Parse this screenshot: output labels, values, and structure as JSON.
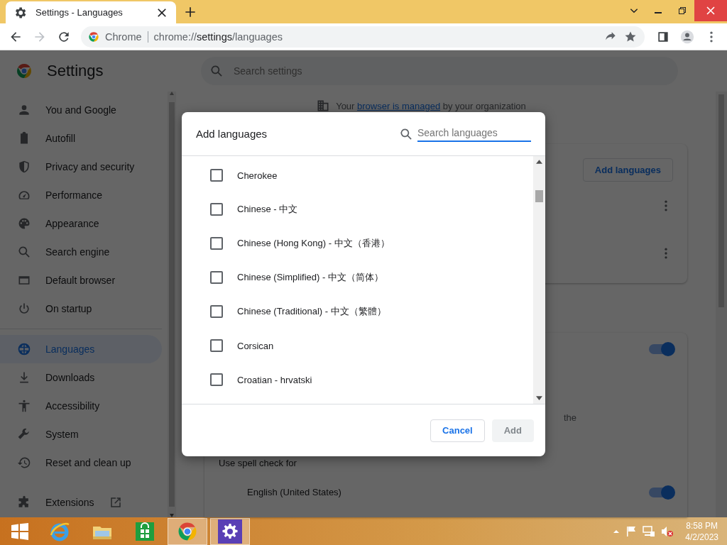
{
  "browser": {
    "tabs": [
      {
        "title": "Settings - Languages",
        "selected": true
      }
    ],
    "address": {
      "site": "Chrome",
      "url_host": "chrome://",
      "url_bold": "settings",
      "url_path": "/languages"
    }
  },
  "settings": {
    "title": "Settings",
    "search": {
      "placeholder": "Search settings"
    },
    "nav": [
      {
        "label": "You and Google",
        "selected": false
      },
      {
        "label": "Autofill",
        "selected": false
      },
      {
        "label": "Privacy and security",
        "selected": false
      },
      {
        "label": "Performance",
        "selected": false
      },
      {
        "label": "Appearance",
        "selected": false
      },
      {
        "label": "Search engine",
        "selected": false
      },
      {
        "label": "Default browser",
        "selected": false
      },
      {
        "label": "On startup",
        "selected": false
      },
      {
        "label": "Languages",
        "selected": true
      },
      {
        "label": "Downloads",
        "selected": false
      },
      {
        "label": "Accessibility",
        "selected": false
      },
      {
        "label": "System",
        "selected": false
      },
      {
        "label": "Reset and clean up",
        "selected": false
      },
      {
        "label": "Extensions",
        "selected": false
      }
    ],
    "managed_notice": {
      "prefix": "Your",
      "link": "browser is managed",
      "suffix": "by your organization"
    },
    "add_languages_button": "Add languages",
    "toggles": [
      {
        "on": true
      }
    ],
    "partial_text": "the",
    "spell_check_label": "Use spell check for",
    "spell_languages": [
      {
        "name": "English (United States)",
        "on": true
      }
    ]
  },
  "dialog": {
    "title": "Add languages",
    "search": {
      "placeholder": "Search languages"
    },
    "languages": [
      {
        "name": "Cherokee",
        "checked": false
      },
      {
        "name": "Chinese - 中文",
        "checked": false
      },
      {
        "name": "Chinese (Hong Kong) - 中文（香港）",
        "checked": false
      },
      {
        "name": "Chinese (Simplified) - 中文（简体）",
        "checked": false
      },
      {
        "name": "Chinese (Traditional) - 中文（繁體）",
        "checked": false
      },
      {
        "name": "Corsican",
        "checked": false
      },
      {
        "name": "Croatian - hrvatski",
        "checked": false
      }
    ],
    "buttons": [
      {
        "label": "Cancel",
        "disabled": false
      },
      {
        "label": "Add",
        "disabled": true
      }
    ]
  },
  "taskbar": {
    "apps": [
      {
        "kind": "ie",
        "active": false
      },
      {
        "kind": "explorer",
        "active": false
      },
      {
        "kind": "store",
        "active": false
      },
      {
        "kind": "chrome",
        "active": true
      },
      {
        "kind": "settings",
        "active": true
      }
    ],
    "time": "8:58 PM",
    "date": "4/2/2023"
  }
}
